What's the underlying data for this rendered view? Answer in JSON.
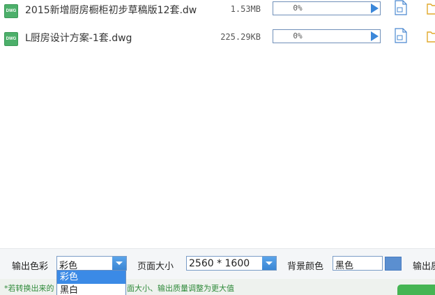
{
  "files": [
    {
      "type_label": "DWG",
      "name": "2015新增厨房橱柜初步草稿版12套.dw",
      "size": "1.53MB",
      "progress_text": "0%",
      "progress_value": 0
    },
    {
      "type_label": "DWG",
      "name": "L厨房设计方案-1套.dwg",
      "size": "225.29KB",
      "progress_text": "0%",
      "progress_value": 0
    }
  ],
  "settings": {
    "output_color_label": "输出色彩",
    "output_color_value": "彩色",
    "page_size_label": "页面大小",
    "page_size_value": "2560 * 1600",
    "bg_color_label": "背景颜色",
    "bg_color_value": "黑色",
    "output_label_partial": "输出质"
  },
  "dropdown": {
    "options": [
      "彩色",
      "黑白"
    ],
    "selected_index": 0
  },
  "hint": {
    "text_left": "*若转换出来的",
    "text_right": "面大小、输出质量调整为更大值"
  },
  "colors": {
    "accent": "#3b8ae6",
    "hint_green": "#2f8a3a",
    "dwg_green": "#4caf6a",
    "start_green": "#45b553"
  }
}
